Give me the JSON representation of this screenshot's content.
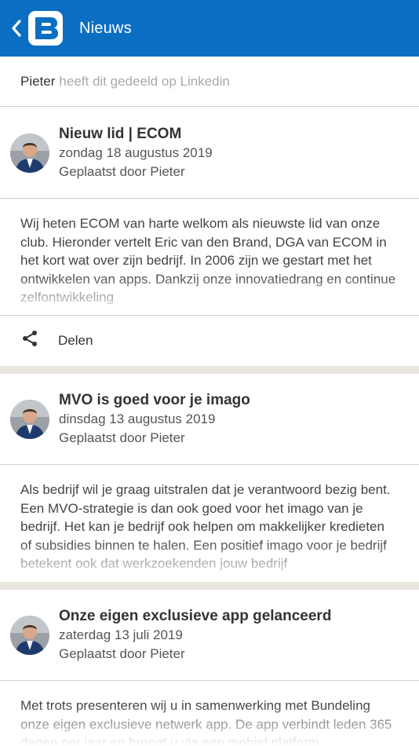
{
  "appbar": {
    "title": "Nieuws",
    "icons": [
      "back-arrow-icon",
      "app-logo"
    ],
    "color": "#0a6fc2"
  },
  "shared": {
    "user": "Pieter",
    "text": "heeft dit gedeeld op Linkedin"
  },
  "posts": [
    {
      "title": "Nieuw lid | ECOM",
      "date": "zondag 18 augustus 2019",
      "author": "Geplaatst door Pieter",
      "excerpt": "Wij heten ECOM van harte welkom als nieuwste lid van onze club. Hieronder vertelt Eric van den Brand, DGA van ECOM in het kort wat over zijn bedrijf. In 2006 zijn we gestart met het ontwikkelen van apps. Dankzij onze innovatiedrang en continue zelfontwikkeling",
      "share_label": "Delen"
    },
    {
      "title": "MVO is goed voor je imago",
      "date": "dinsdag 13 augustus 2019",
      "author": "Geplaatst door Pieter",
      "excerpt": "Als bedrijf wil je graag uitstralen dat je verantwoord bezig bent. Een MVO-strategie is dan ook goed voor het imago van je bedrijf. Het kan je bedrijf ook helpen om makkelijker kredieten of subsidies binnen te halen. Een positief imago voor je bedrijf betekent ook dat werkzoekenden jouw bedrijf"
    },
    {
      "title": "Onze eigen exclusieve app gelanceerd",
      "date": "zaterdag 13 juli 2019",
      "author": "Geplaatst door Pieter",
      "excerpt": "Met trots presenteren wij u in samenwerking met Bundeling onze eigen exclusieve netwerk app. De app verbindt leden 365 dagen per jaar en brengt u via een mobiel platform"
    }
  ]
}
